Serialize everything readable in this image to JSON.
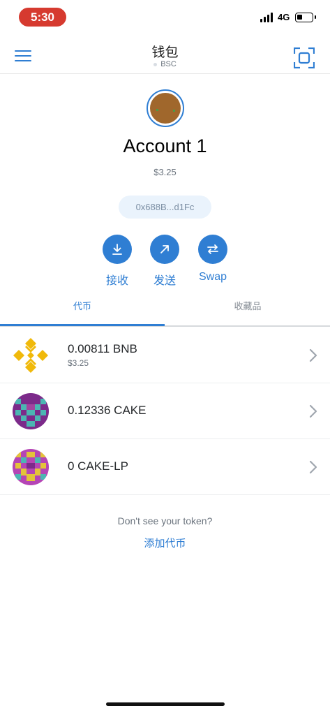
{
  "status_bar": {
    "time": "5:30",
    "network": "4G"
  },
  "header": {
    "title": "钱包",
    "network": "BSC",
    "icons": [
      "hamburger-menu-icon",
      "scan-icon"
    ]
  },
  "account": {
    "name": "Account 1",
    "balance": "$3.25",
    "address": "0x688B...d1Fc"
  },
  "actions": [
    {
      "label": "接收",
      "icon": "receive-icon"
    },
    {
      "label": "发送",
      "icon": "send-icon"
    },
    {
      "label": "Swap",
      "icon": "swap-icon"
    }
  ],
  "tabs": [
    {
      "label": "代币",
      "active": true
    },
    {
      "label": "收藏品",
      "active": false
    }
  ],
  "tokens": [
    {
      "amount": "0.00811 BNB",
      "fiat": "$3.25",
      "icon": "bnb-icon"
    },
    {
      "amount": "0.12336 CAKE",
      "fiat": "",
      "icon": "cake-icon"
    },
    {
      "amount": "0 CAKE-LP",
      "fiat": "",
      "icon": "cake-lp-icon"
    }
  ],
  "footer": {
    "missing_token_text": "Don't see your token?",
    "add_token_link": "添加代币"
  },
  "colors": {
    "accent": "#2f7ed3",
    "status_pill": "#d63a2f",
    "bnb": "#f0b90b"
  }
}
